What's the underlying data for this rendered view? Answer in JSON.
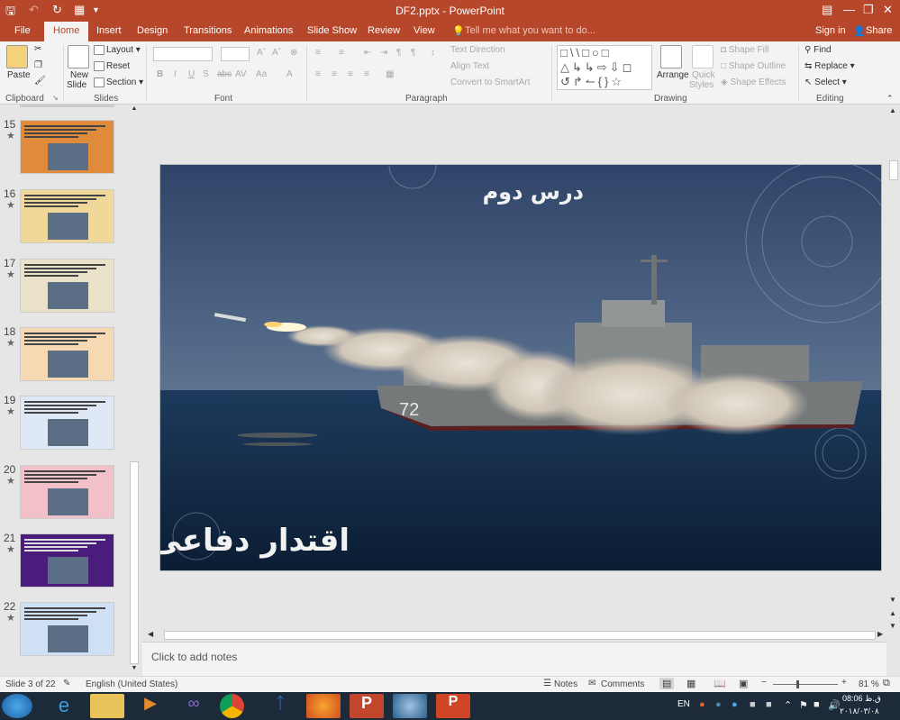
{
  "window": {
    "title": "DF2.pptx - PowerPoint"
  },
  "tabs": [
    {
      "label": "File"
    },
    {
      "label": "Home"
    },
    {
      "label": "Insert"
    },
    {
      "label": "Design"
    },
    {
      "label": "Transitions"
    },
    {
      "label": "Animations"
    },
    {
      "label": "Slide Show"
    },
    {
      "label": "Review"
    },
    {
      "label": "View"
    }
  ],
  "tell_me": "Tell me what you want to do...",
  "account": {
    "sign_in": "Sign in",
    "share": "Share"
  },
  "ribbon": {
    "clipboard": {
      "paste": "Paste",
      "group": "Clipboard"
    },
    "slides": {
      "new_slide": "New",
      "new_slide2": "Slide",
      "layout": "Layout",
      "reset": "Reset",
      "section": "Section",
      "group": "Slides"
    },
    "font": {
      "group": "Font"
    },
    "paragraph": {
      "text_direction": "Text Direction",
      "align_text": "Align Text",
      "convert_smartart": "Convert to SmartArt",
      "group": "Paragraph"
    },
    "drawing": {
      "arrange": "Arrange",
      "quick_styles": "Quick",
      "quick_styles2": "Styles",
      "shape_fill": "Shape Fill",
      "shape_outline": "Shape Outline",
      "shape_effects": "Shape Effects",
      "group": "Drawing"
    },
    "editing": {
      "find": "Find",
      "replace": "Replace",
      "select": "Select",
      "group": "Editing"
    }
  },
  "thumbnails": [
    {
      "num": "15",
      "bg": "#e08a3c"
    },
    {
      "num": "16",
      "bg": "#f0d79a"
    },
    {
      "num": "17",
      "bg": "#e9e2c8"
    },
    {
      "num": "18",
      "bg": "#f6d9b3"
    },
    {
      "num": "19",
      "bg": "#dfe9f5"
    },
    {
      "num": "20",
      "bg": "#f2c0c8"
    },
    {
      "num": "21",
      "bg": "#4a1d7c"
    },
    {
      "num": "22",
      "bg": "#cfe0f5"
    }
  ],
  "slide": {
    "title_text": "درس دوم",
    "subtitle_text": "اقتدار دفاعی",
    "hull_number": "72",
    "colors": {
      "sky_top": "#2f4468",
      "sky_bottom": "#5c7290",
      "sea_top": "#1d3a5c",
      "sea_bottom": "#0b1d33"
    }
  },
  "notes_placeholder": "Click to add notes",
  "status": {
    "slide_info": "Slide 3 of 22",
    "language": "English (United States)",
    "notes": "Notes",
    "comments": "Comments",
    "zoom": "81 %"
  },
  "clock": {
    "time": "08:06 ق.ظ",
    "date": "۲۰۱۸/۰۳/۰۸"
  },
  "tray": {
    "lang": "EN"
  }
}
